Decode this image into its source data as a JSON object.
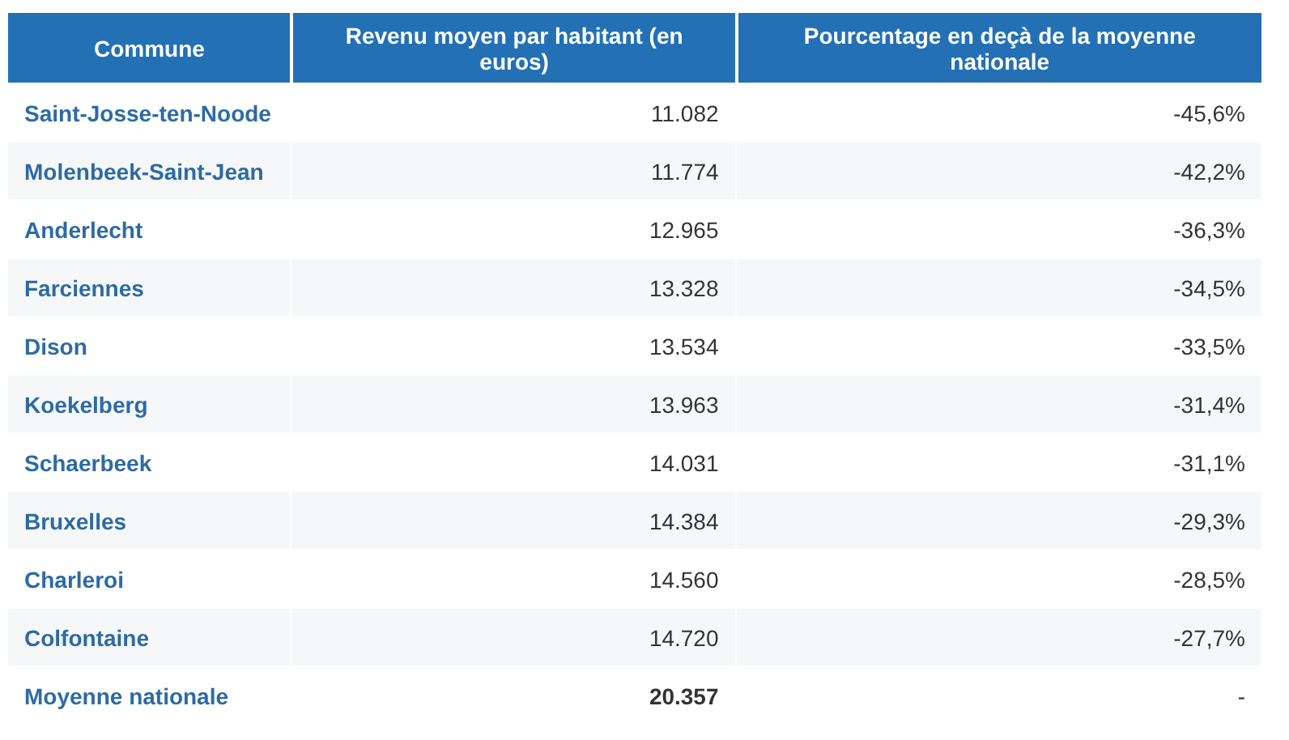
{
  "table": {
    "columns": [
      "Commune",
      "Revenu moyen par habitant (en euros)",
      "Pourcentage en deçà de la moyenne nationale"
    ],
    "rows": [
      {
        "kind": "commune",
        "cells": [
          "Saint-Josse-ten-Noode",
          "11.082",
          "-45,6%"
        ]
      },
      {
        "kind": "commune",
        "cells": [
          "Molenbeek-Saint-Jean",
          "11.774",
          "-42,2%"
        ]
      },
      {
        "kind": "commune",
        "cells": [
          "Anderlecht",
          "12.965",
          "-36,3%"
        ]
      },
      {
        "kind": "commune",
        "cells": [
          "Farciennes",
          "13.328",
          "-34,5%"
        ]
      },
      {
        "kind": "commune",
        "cells": [
          "Dison",
          "13.534",
          "-33,5%"
        ]
      },
      {
        "kind": "commune",
        "cells": [
          "Koekelberg",
          "13.963",
          "-31,4%"
        ]
      },
      {
        "kind": "commune",
        "cells": [
          "Schaerbeek",
          "14.031",
          "-31,1%"
        ]
      },
      {
        "kind": "commune",
        "cells": [
          "Bruxelles",
          "14.384",
          "-29,3%"
        ]
      },
      {
        "kind": "commune",
        "cells": [
          "Charleroi",
          "14.560",
          "-28,5%"
        ]
      },
      {
        "kind": "commune",
        "cells": [
          "Colfontaine",
          "14.720",
          "-27,7%"
        ]
      },
      {
        "kind": "total",
        "cells": [
          "Moyenne nationale",
          "20.357",
          "-"
        ]
      }
    ]
  }
}
